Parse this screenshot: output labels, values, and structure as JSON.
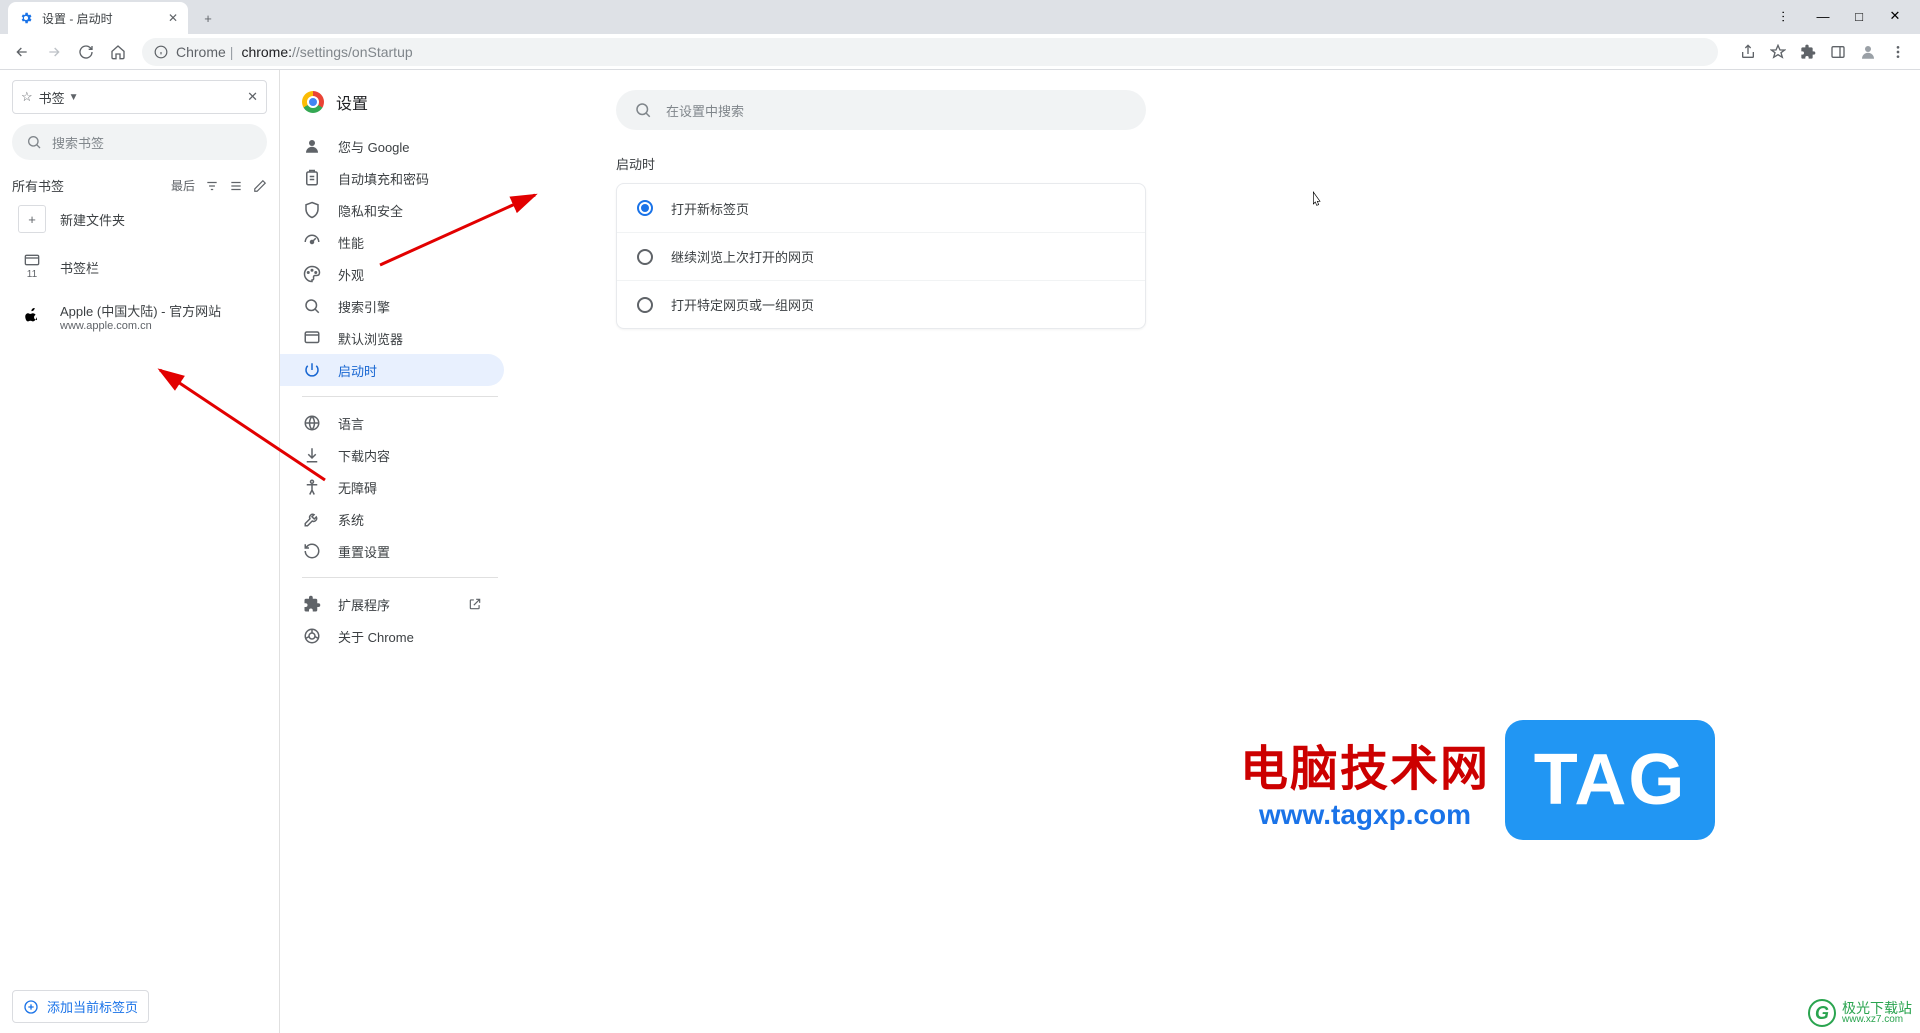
{
  "tab": {
    "title": "设置 - 启动时"
  },
  "omnibox": {
    "scheme_lock": "Chrome",
    "sep": " | ",
    "host": "chrome:",
    "path": "//settings/onStartup"
  },
  "bookmarks": {
    "menu_label": "书签",
    "search_placeholder": "搜索书签",
    "all_label": "所有书签",
    "sort_label": "最后",
    "new_folder": "新建文件夹",
    "bar_label": "书签栏",
    "bar_count": "11",
    "apple_title": "Apple (中国大陆) - 官方网站",
    "apple_url": "www.apple.com.cn",
    "add_current": "添加当前标签页"
  },
  "settings_header": "设置",
  "search_settings_placeholder": "在设置中搜索",
  "nav": {
    "items": [
      {
        "label": "您与 Google"
      },
      {
        "label": "自动填充和密码"
      },
      {
        "label": "隐私和安全"
      },
      {
        "label": "性能"
      },
      {
        "label": "外观"
      },
      {
        "label": "搜索引擎"
      },
      {
        "label": "默认浏览器"
      },
      {
        "label": "启动时"
      }
    ],
    "items2": [
      {
        "label": "语言"
      },
      {
        "label": "下载内容"
      },
      {
        "label": "无障碍"
      },
      {
        "label": "系统"
      },
      {
        "label": "重置设置"
      }
    ],
    "ext": "扩展程序",
    "about": "关于 Chrome"
  },
  "startup": {
    "section": "启动时",
    "opt1": "打开新标签页",
    "opt2": "继续浏览上次打开的网页",
    "opt3": "打开特定网页或一组网页"
  },
  "wm": {
    "cn": "电脑技术网",
    "url": "www.tagxp.com",
    "tag": "TAG",
    "corner1": "极光下载站",
    "corner2": "www.xz7.com"
  }
}
